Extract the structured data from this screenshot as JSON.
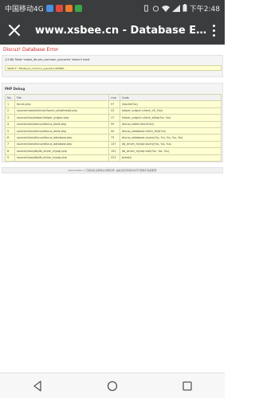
{
  "status_bar": {
    "carrier": "中国移动4G",
    "time": "下午2:48",
    "notification_colors": [
      "#4a8fe0",
      "#e24b3c",
      "#ee7a2b",
      "#3da547"
    ]
  },
  "toolbar": {
    "title": "www.xsbee.cn - Database Er...",
    "close_icon": "close-icon",
    "menu_icon": "more-vert-icon"
  },
  "page": {
    "error_title": "Discuz! Database Error",
    "error_message": "(1146) Table 'xsbee_db.pre_common_syscache' doesn't exist",
    "sql_line": "SELECT * FROM pre_common_syscache WHERE ...",
    "php_title": "PHP Debug",
    "trace_headers": [
      "No.",
      "File",
      "Line",
      "Code"
    ],
    "trace_rows": [
      [
        "1",
        "forum.php",
        "57",
        "require(%s)"
      ],
      [
        "2",
        "source/module/forum/forum_viewthread.php",
        "23",
        "helper_output::check_h5_(%s)"
      ],
      [
        "3",
        "source/class/helper/helper_output.php",
        "17",
        "helper_output::check_allow(%s, %s)"
      ],
      [
        "4",
        "source/class/discuz/discuz_table.php",
        "59",
        "discuz_table::fetch(%d)"
      ],
      [
        "5",
        "source/class/discuz/discuz_table.php",
        "44",
        "discuz_database::fetch_first(%s)"
      ],
      [
        "6",
        "source/class/discuz/discuz_database.php",
        "73",
        "discuz_database::query(%s, %s, %s, %s, %s)"
      ],
      [
        "7",
        "source/class/discuz/discuz_database.php",
        "137",
        "db_driver_mysql::query(%s, %s, %s)"
      ],
      [
        "8",
        "source/class/db/db_driver_mysql.php",
        "152",
        "db_driver_mysql::halt(%s, %d, %s)"
      ],
      [
        "9",
        "source/class/db/db_driver_mysql.php",
        "223",
        "break()"
      ]
    ],
    "footer": "www.xsbee.cn 已经将此出错信息详细记录, 由此给您带来的访问不便我们深感歉意"
  }
}
